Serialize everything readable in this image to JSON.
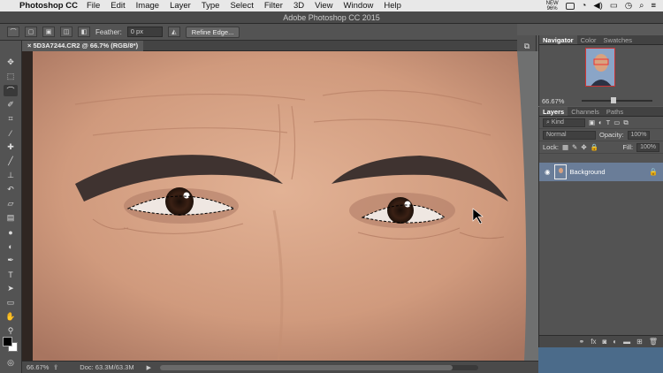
{
  "menubar": {
    "app": "Photoshop CC",
    "items": [
      "File",
      "Edit",
      "Image",
      "Layer",
      "Type",
      "Select",
      "Filter",
      "3D",
      "View",
      "Window",
      "Help"
    ],
    "status_badge_top": "NEW",
    "battery": "96%"
  },
  "window": {
    "title": "Adobe Photoshop CC 2015"
  },
  "options": {
    "feather_label": "Feather:",
    "feather_value": "0 px",
    "refine_edge": "Refine Edge..."
  },
  "document": {
    "tab_label": "5D3A7244.CR2 @ 66.7% (RGB/8*)"
  },
  "status": {
    "zoom": "66.67%",
    "doc_info": "Doc: 63.3M/63.3M",
    "scroll_position": 0.92
  },
  "navigator": {
    "tabs": [
      "Navigator",
      "Color",
      "Swatches"
    ],
    "zoom": "66.67%",
    "zoom_slider_level": 0.45
  },
  "layers": {
    "tabs": [
      "Layers",
      "Channels",
      "Paths"
    ],
    "kind_label": "Kind",
    "blend_mode": "Normal",
    "opacity_label": "Opacity:",
    "opacity_value": "100%",
    "lock_label": "Lock:",
    "fill_label": "Fill:",
    "fill_value": "100%",
    "layer_name": "Background"
  },
  "colors": {
    "accent": "#6a7d98",
    "skin": "#d9a68a",
    "ui_dark": "#535353"
  }
}
